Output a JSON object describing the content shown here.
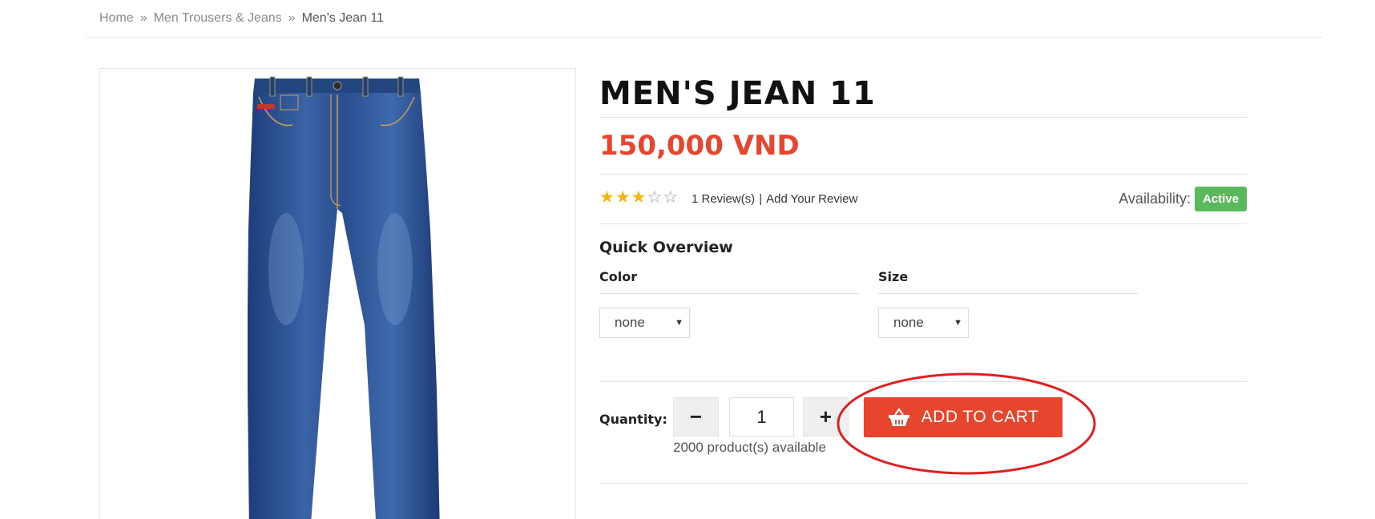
{
  "breadcrumb": {
    "home": "Home",
    "separator": "»",
    "category": "Men Trousers & Jeans",
    "current": "Men's Jean 11"
  },
  "product": {
    "title": "MEN'S JEAN 11",
    "price": "150,000 VND",
    "rating": 3,
    "rating_max": 5,
    "reviews_count_text": "1 Review(s)",
    "review_separator": "|",
    "add_review_text": "Add Your Review",
    "availability_label": "Availability:",
    "availability_status": "Active",
    "image_icon": "blue-jeans-image"
  },
  "overview": {
    "title": "Quick Overview",
    "color_label": "Color",
    "color_value": "none",
    "size_label": "Size",
    "size_value": "none"
  },
  "quantity": {
    "label": "Quantity:",
    "minus": "−",
    "value": "1",
    "plus": "+",
    "stock_text": "2000 product(s) available"
  },
  "cart": {
    "button_label": "ADD TO CART",
    "icon": "basket-icon"
  },
  "colors": {
    "accent": "#e8452f",
    "availability_badge": "#5cb85c",
    "star": "#f5b50a",
    "annotation_circle": "#e02020"
  }
}
